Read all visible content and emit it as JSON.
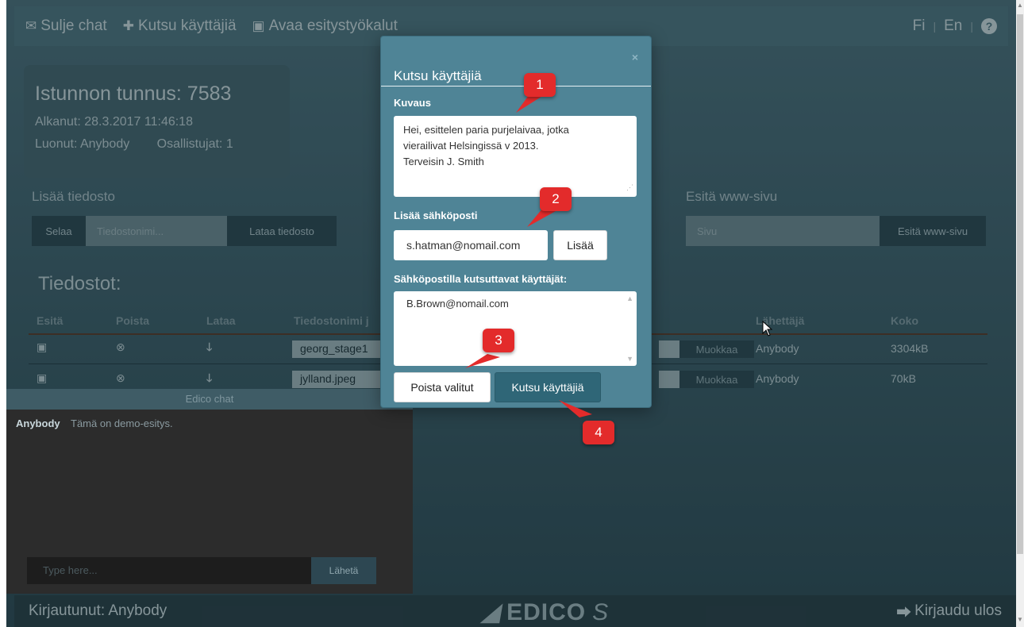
{
  "topbar": {
    "close_chat": "Sulje chat",
    "invite_users": "Kutsu käyttäjiä",
    "open_tools": "Avaa esitystyökalut",
    "lang_fi": "Fi",
    "lang_en": "En",
    "sep": "|",
    "help": "?"
  },
  "session": {
    "title": "Istunnon tunnus: 7583",
    "started": "Alkanut: 28.3.2017 11:46:18",
    "creator": "Luonut: Anybody",
    "participants": "Osallistujat: 1"
  },
  "add_file": {
    "label": "Lisää tiedosto",
    "browse": "Selaa",
    "filename_placeholder": "Tiedostonimi...",
    "upload": "Lataa tiedosto"
  },
  "www": {
    "label": "Esitä www-sivu",
    "placeholder": "Sivu",
    "button": "Esitä www-sivu"
  },
  "files": {
    "title": "Tiedostot:",
    "columns": [
      "Esitä",
      "Poista",
      "Lataa",
      "Tiedostonimi j",
      "Lähettäjä",
      "Koko"
    ],
    "rows": [
      {
        "name": "georg_stage1",
        "edit": "Muokkaa",
        "sender": "Anybody",
        "size": "3304kB"
      },
      {
        "name": "jylland.jpeg",
        "edit": "Muokkaa",
        "sender": "Anybody",
        "size": "70kB"
      }
    ]
  },
  "chat": {
    "header": "Edico chat",
    "messages": [
      {
        "who": "Anybody",
        "text": "Tämä on demo-esitys."
      }
    ],
    "input_placeholder": "Type here...",
    "send": "Lähetä"
  },
  "footer": {
    "logged_in": "Kirjautunut: Anybody",
    "logo": "EDICO",
    "logo_s": "S",
    "logout": "Kirjaudu ulos"
  },
  "modal": {
    "title": "Kutsu käyttäjiä",
    "close": "×",
    "description_label": "Kuvaus",
    "description_lines": [
      "Hei, esittelen paria purjelaivaa, jotka",
      "vierailivat Helsingissä v 2013.",
      "Terveisin J. Smith"
    ],
    "add_email_label": "Lisää sähköposti",
    "email_value": "s.hatman@nomail.com",
    "add_button": "Lisää",
    "invited_label": "Sähköpostilla kutsuttavat käyttäjät:",
    "invited": [
      "B.Brown@nomail.com"
    ],
    "remove_button": "Poista valitut",
    "invite_button": "Kutsu käyttäjiä"
  },
  "callouts": [
    "1",
    "2",
    "3",
    "4"
  ],
  "colors": {
    "modal_bg": "#4f8496",
    "callout": "#e32b2b",
    "invite_button": "#2f6677"
  }
}
